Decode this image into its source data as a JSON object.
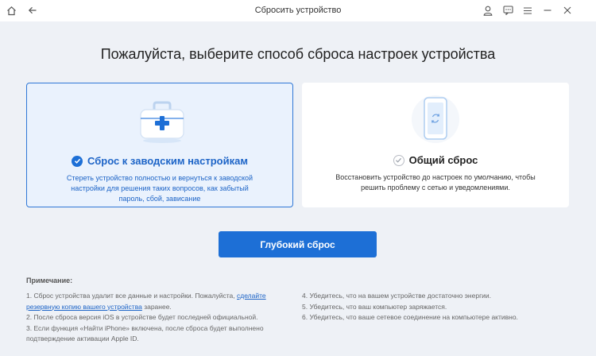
{
  "window": {
    "title": "Сбросить устройство",
    "icons": [
      "home-icon",
      "back-arrow-icon",
      "user-icon",
      "feedback-icon",
      "menu-icon",
      "minimize-icon",
      "close-icon"
    ]
  },
  "heading": "Пожалуйста, выберите способ сброса настроек устройства",
  "options": [
    {
      "title": "Сброс к заводским настройкам",
      "description": "Стереть устройство полностью и вернуться к заводской настройки для решения таких вопросов, как забытый пароль, сбой, зависание",
      "selected": true,
      "icon": "first-aid-kit-icon"
    },
    {
      "title": "Общий сброс",
      "description": "Восстановить устройство до настроек по умолчанию, чтобы решить проблему с сетью и уведомлениями.",
      "selected": false,
      "icon": "phone-reset-icon"
    }
  ],
  "primary_button": "Глубокий сброс",
  "notes": {
    "title": "Примечание:",
    "item1_before": "1. Сброс устройства удалит все данные и настройки. Пожалуйста, ",
    "item1_link": "сделайте резервную копию вашего устройства",
    "item1_after": " заранее.",
    "item2": "2. После сброса версия iOS в устройстве будет последней официальной.",
    "item3": "3. Если функция «Найти iPhone» включена, после сброса будет выполнено подтверждение активации Apple ID.",
    "item4": "4. Убедитесь, что на вашем устройстве достаточно энергии.",
    "item5": "5. Убедитесь, что ваш компьютер заряжается.",
    "item6": "6. Убедитесь, что ваше сетевое соединение на компьютере активно."
  },
  "colors": {
    "accent": "#1d6fd6",
    "selected_bg": "#eaf2fd",
    "page_bg": "#eef1f6"
  }
}
